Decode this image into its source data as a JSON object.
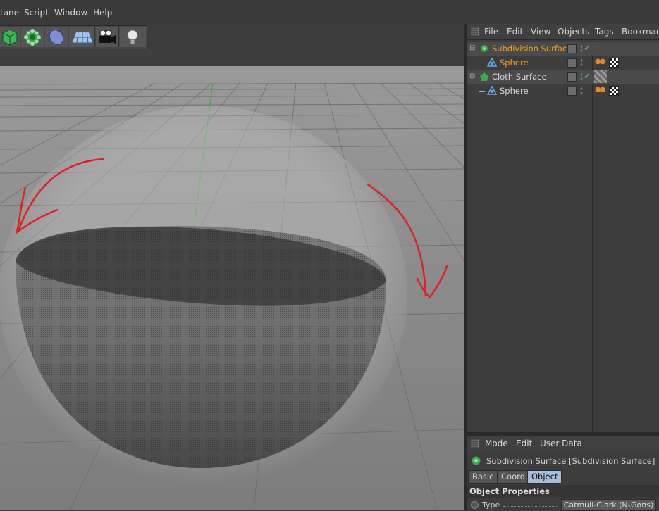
{
  "menubar": {
    "items": [
      "tane",
      "Script",
      "Window",
      "Help"
    ]
  },
  "toolbar": {
    "tools": [
      "cube-icon",
      "subdivision-icon",
      "deformer-icon",
      "floor-icon",
      "camera-icon",
      "light-icon"
    ]
  },
  "viewport": {
    "nav_icons": "✥⬍⟳⧉"
  },
  "object_manager": {
    "menu": [
      "File",
      "Edit",
      "View",
      "Objects",
      "Tags",
      "Bookmark"
    ],
    "objects": [
      {
        "name": "Subdivision Surface",
        "color": "#f0a020",
        "level": 0,
        "tags": []
      },
      {
        "name": "Sphere",
        "color": "#f0a020",
        "level": 1,
        "tags": [
          "phong-tag",
          "material-tag"
        ]
      },
      {
        "name": "Cloth Surface",
        "color": "#d8d8d8",
        "level": 0,
        "tags": [
          "cloth-tag"
        ]
      },
      {
        "name": "Sphere",
        "color": "#d8d8d8",
        "level": 1,
        "tags": [
          "phong-tag",
          "material-tag"
        ]
      }
    ]
  },
  "attribute_manager": {
    "menu": [
      "Mode",
      "Edit",
      "User Data"
    ],
    "title": "Subdivision Surface [Subdivision Surface]",
    "tabs": [
      "Basic",
      "Coord.",
      "Object"
    ],
    "active_tab": "Object",
    "section": "Object Properties",
    "param_label": "Type",
    "param_value": "Catmull-Clark (N-Gons)"
  },
  "colors": {
    "selected_text": "#f0a020",
    "active_tab": "#a6bcd8",
    "annotation": "#e02020"
  }
}
